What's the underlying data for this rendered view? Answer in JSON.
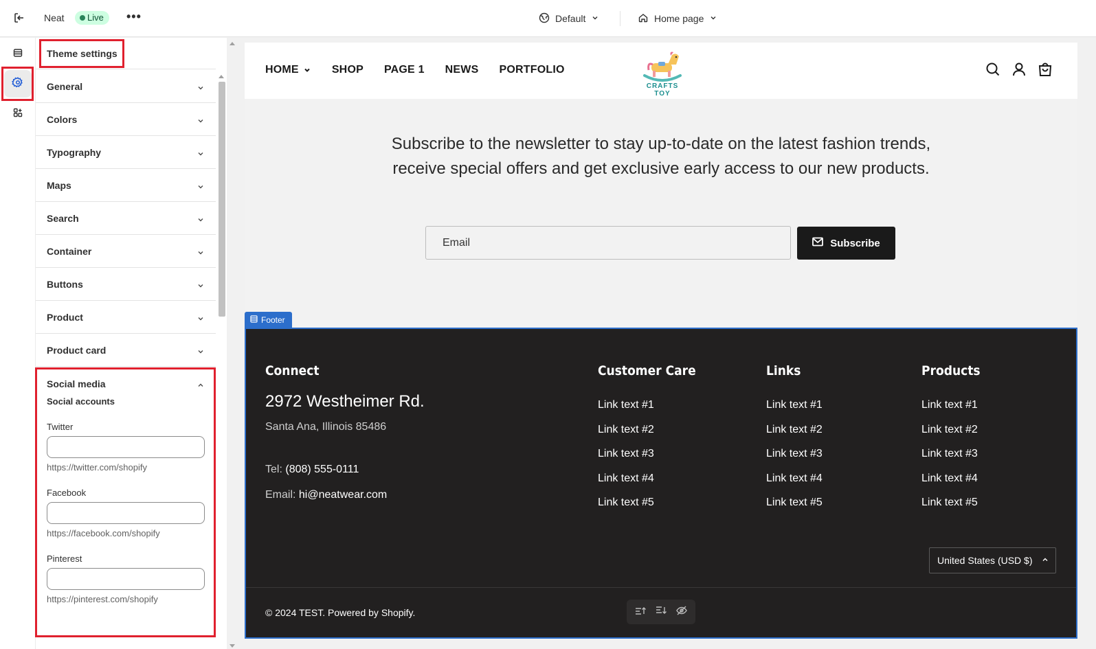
{
  "topbar": {
    "store_name": "Neat",
    "status": "Live",
    "more": "•••",
    "theme_selector": "Default",
    "page_selector": "Home page"
  },
  "panel": {
    "title": "Theme settings",
    "sections": [
      "General",
      "Colors",
      "Typography",
      "Maps",
      "Search",
      "Container",
      "Buttons",
      "Product",
      "Product card"
    ],
    "social": {
      "title": "Social media",
      "subtitle": "Social accounts",
      "fields": [
        {
          "label": "Twitter",
          "value": "",
          "help": "https://twitter.com/shopify"
        },
        {
          "label": "Facebook",
          "value": "",
          "help": "https://facebook.com/shopify"
        },
        {
          "label": "Pinterest",
          "value": "",
          "help": "https://pinterest.com/shopify"
        }
      ]
    }
  },
  "store": {
    "nav": [
      "HOME",
      "SHOP",
      "PAGE 1",
      "NEWS",
      "PORTFOLIO"
    ],
    "logo_text": "CRAFTS TOY",
    "newsletter_text": "Subscribe to the newsletter to stay up-to-date on the latest fashion trends, receive special offers and get exclusive early access to our new products.",
    "email_placeholder": "Email",
    "subscribe_label": "Subscribe"
  },
  "footer": {
    "tag": "Footer",
    "connect": {
      "title": "Connect",
      "address1": "2972 Westheimer Rd.",
      "address2": "Santa Ana, Illinois 85486",
      "tel_label": "Tel:",
      "tel": "(808) 555-0111",
      "email_label": "Email:",
      "email": "hi@neatwear.com"
    },
    "columns": [
      {
        "title": "Customer Care",
        "links": [
          "Link text #1",
          "Link text #2",
          "Link text #3",
          "Link text #4",
          "Link text #5"
        ]
      },
      {
        "title": "Links",
        "links": [
          "Link text #1",
          "Link text #2",
          "Link text #3",
          "Link text #4",
          "Link text #5"
        ]
      },
      {
        "title": "Products",
        "links": [
          "Link text #1",
          "Link text #2",
          "Link text #3",
          "Link text #4",
          "Link text #5"
        ]
      }
    ],
    "currency": "United States (USD $)",
    "copyright": "© 2024 TEST. Powered by Shopify."
  },
  "colors": {
    "accent_blue": "#2c6ecb",
    "highlight_red": "#e0202e",
    "footer_bg": "#222020",
    "live_badge_bg": "#cdfee1"
  }
}
